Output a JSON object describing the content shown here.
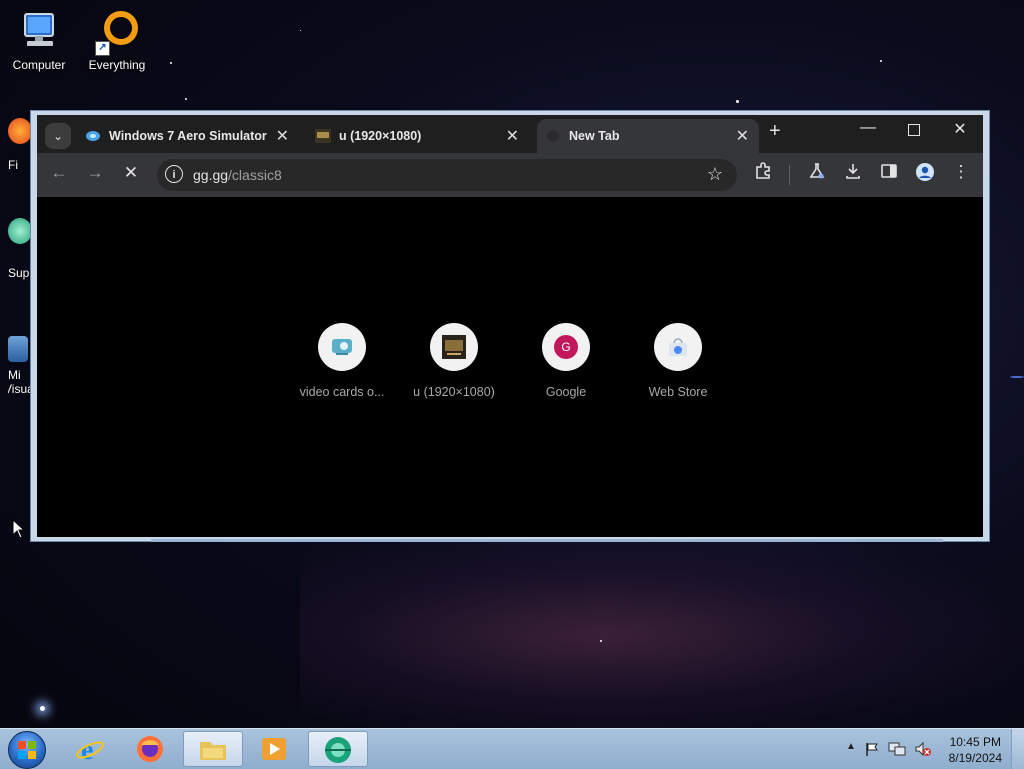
{
  "desktop": {
    "icons": [
      {
        "label": "Computer",
        "icon": "computer-icon"
      },
      {
        "label": "Everything",
        "icon": "everything-icon"
      }
    ],
    "edge_labels": [
      "Fi",
      "Sup",
      "Mi",
      "Visua"
    ]
  },
  "browser": {
    "tabs": [
      {
        "title": "Windows 7 Aero Simulator (",
        "icon": "aero-simulator-favicon",
        "active": false
      },
      {
        "title": "u (1920×1080)",
        "icon": "image-favicon",
        "active": false
      },
      {
        "title": "New Tab",
        "icon": "chrome-favicon",
        "active": true
      }
    ],
    "omnibox": {
      "domain": "gg.gg",
      "path": "/classic8"
    },
    "shortcuts": [
      {
        "label": "video cards o...",
        "icon": "video-cards-icon"
      },
      {
        "label": "u (1920×1080)",
        "icon": "image-thumbnail-icon"
      },
      {
        "label": "Google",
        "icon": "google-icon",
        "letter": "G"
      },
      {
        "label": "Web Store",
        "icon": "web-store-icon"
      }
    ]
  },
  "taskbar": {
    "pinned": [
      "internet-explorer-icon",
      "firefox-icon",
      "file-explorer-icon",
      "media-player-icon",
      "browser-icon"
    ],
    "clock": {
      "time": "10:45 PM",
      "date": "8/19/2024"
    },
    "tray_icons": [
      "show-hidden-icons",
      "action-center-flag-icon",
      "network-icon",
      "volume-muted-icon"
    ]
  }
}
